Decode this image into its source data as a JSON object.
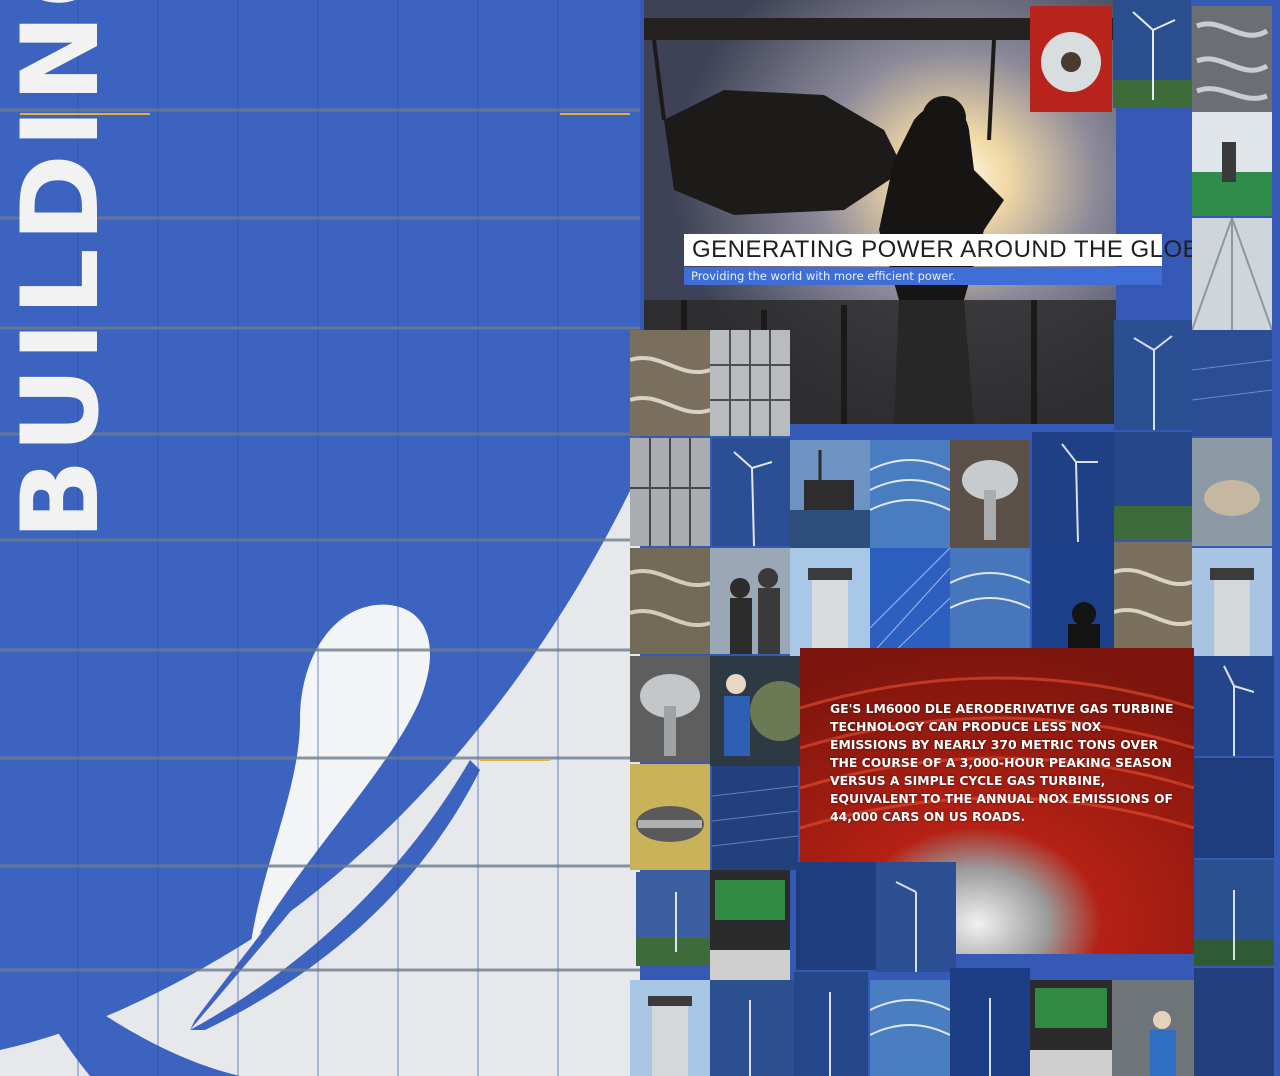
{
  "left_panel": {
    "vertical_word": "BUILDING",
    "colors": {
      "background": "#3b63bf",
      "swoosh": "#eceef2",
      "word": "#f2f2f2"
    }
  },
  "hero": {
    "title": "GENERATING POWER AROUND THE GLOBE",
    "subtitle": "Providing the world with more efficient power."
  },
  "fact": {
    "text": "GE's LM6000 DLE aeroderivative gas turbine technology can produce less NOx emissions by nearly 370 metric tons over the course of a 3,000-hour peaking season versus a simple cycle gas turbine, equivalent to the annual NOx emissions of 44,000 cars on US roads."
  },
  "tiles": [
    "turbine-engine-icon",
    "wind-turbine-icon",
    "factory-hall-icon",
    "offshore-platform-icon",
    "solar-panel-icon",
    "cooling-tower-icon",
    "control-room-icon",
    "workers-icon",
    "building-facade-icon"
  ]
}
